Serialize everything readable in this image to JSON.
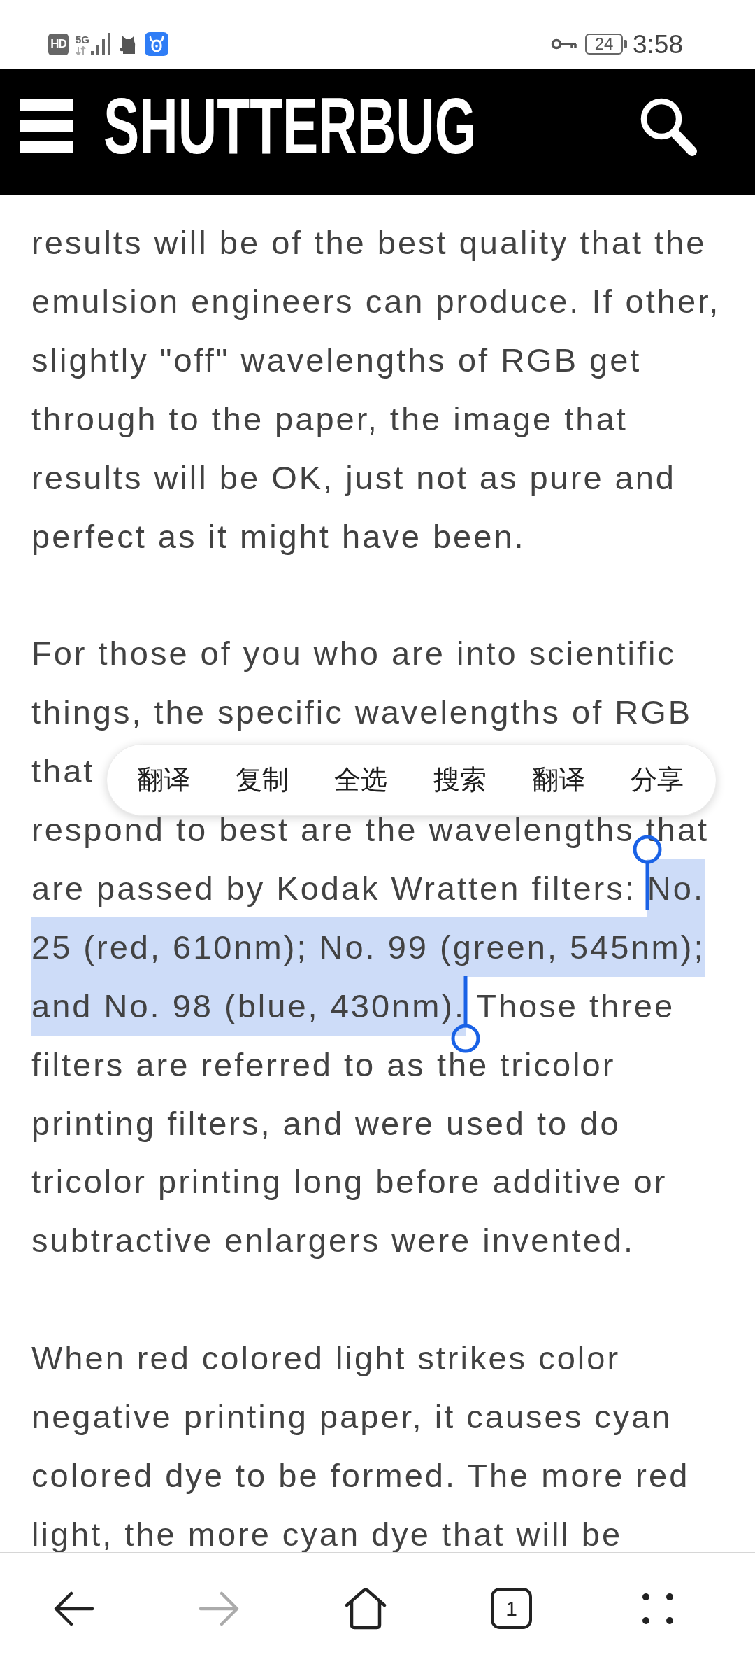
{
  "status_bar": {
    "hd_label": "HD",
    "network_label": "5G",
    "battery": "24",
    "time": "3:58"
  },
  "header": {
    "logo": "SHUTTERBUG"
  },
  "article": {
    "paragraphs": [
      {
        "segments": [
          {
            "text": "results will be of the best quality that the\nemulsion engineers can produce. If other,\nslightly \"off\" wavelengths of RGB get\nthrough to the paper, the image that\nresults will be OK, just not as pure and\nperfect as it might have been.",
            "selected": false
          }
        ]
      },
      {
        "segments": [
          {
            "text": "For those of you who are into scientific\nthings, the specific wavelengths of RGB\nthat\nrespond to best are the wavelengths that\nare passed by Kodak Wratten filters: ",
            "selected": false
          },
          {
            "text": "No.\n25 (red, 610nm); No. 99 (green, 545nm);\nand No. 98 (blue, 430nm).",
            "selected": true
          },
          {
            "text": " Those three\nfilters are referred to as the tricolor\nprinting filters, and were used to do\ntricolor printing long before additive or\nsubtractive enlargers were invented.",
            "selected": false
          }
        ]
      },
      {
        "segments": [
          {
            "text": "When red colored light strikes color\nnegative printing paper, it causes cyan\ncolored dye to be formed. The more red\nlight, the more cyan dye that will be",
            "selected": false
          }
        ]
      }
    ]
  },
  "selection_menu": {
    "items": [
      "翻译",
      "复制",
      "全选",
      "搜索",
      "翻译",
      "分享"
    ]
  },
  "toolbar": {
    "buttons": [
      {
        "kind": "back",
        "disabled": false
      },
      {
        "kind": "forward",
        "disabled": true
      },
      {
        "kind": "home",
        "disabled": false
      },
      {
        "kind": "tabs",
        "count": "1",
        "disabled": false
      },
      {
        "kind": "more",
        "disabled": false
      }
    ]
  }
}
